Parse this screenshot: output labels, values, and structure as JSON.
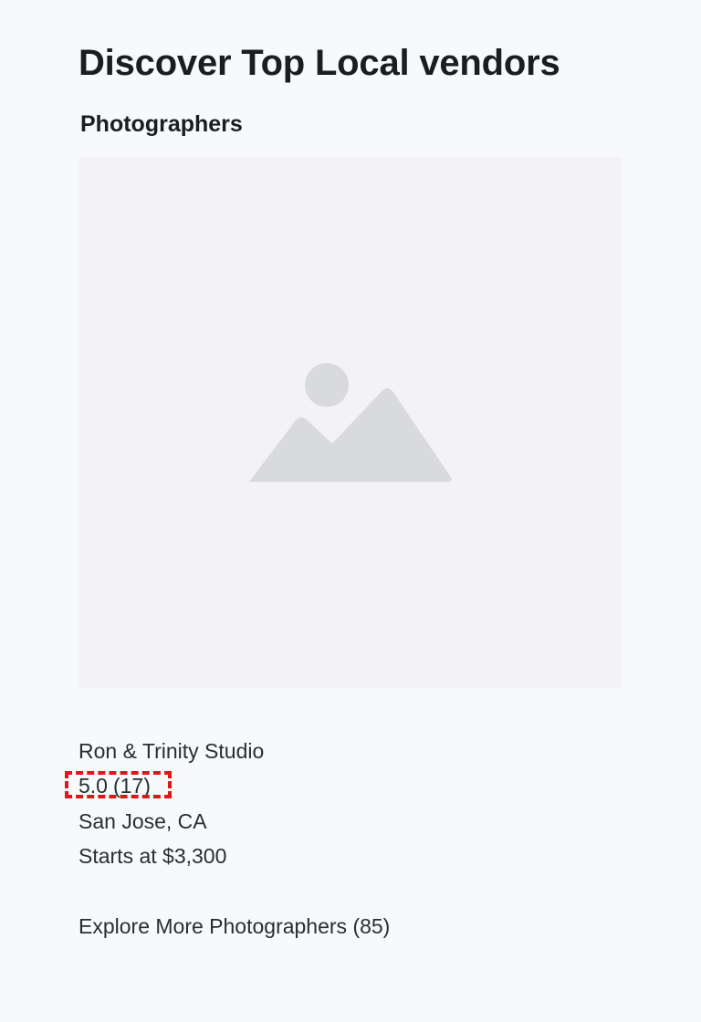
{
  "page": {
    "title": "Discover Top Local vendors"
  },
  "section": {
    "title": "Photographers"
  },
  "vendor": {
    "image_icon": "image-placeholder-icon",
    "name": "Ron & Trinity Studio",
    "rating": {
      "score": "5.0",
      "count": "(17)"
    },
    "location": "San  Jose, CA",
    "price": "Starts at  $3,300"
  },
  "explore": {
    "label": "Explore More Photographers (85)"
  },
  "colors": {
    "background": "#f8f9fb",
    "image_background": "#f3f3f5",
    "placeholder_icon": "#d9dadd",
    "highlight": "#e0161b",
    "text": "#2a2d33"
  }
}
